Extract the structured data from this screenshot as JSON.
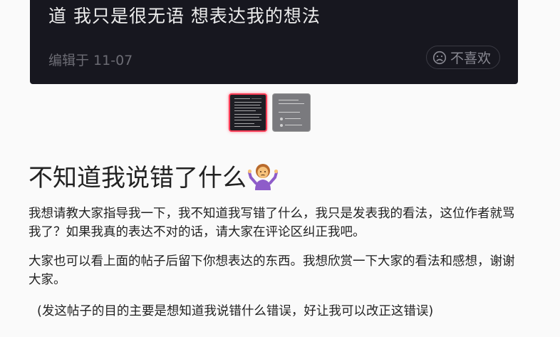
{
  "post_image": {
    "text": "道 我只是很无语 想表达我的想法",
    "edit_date": "编辑于 11-07",
    "dislike_label": "不喜欢"
  },
  "thumbnails": [
    {
      "name": "thumbnail-1",
      "selected": true
    },
    {
      "name": "thumbnail-2",
      "selected": false
    }
  ],
  "article": {
    "title": "不知道我说错了什么",
    "title_emoji": "shrugging-person-emoji",
    "paragraph_1": "我想请教大家指导我一下，我不知道我写错了什么，我只是发表我的看法，这位作者就骂我了？如果我真的表达不对的话，请大家在评论区纠正我吧。",
    "paragraph_2": "大家也可以看上面的帖子后留下你想表达的东西。我想欣赏一下大家的看法和感想，谢谢大家。",
    "paragraph_3": "(发这帖子的目的主要是想知道我说错什么错误，好让我可以改正这错误)"
  },
  "colors": {
    "dark_card": "#17171f",
    "thumb_selected_border": "#ff3d57",
    "text_primary": "#222222"
  }
}
